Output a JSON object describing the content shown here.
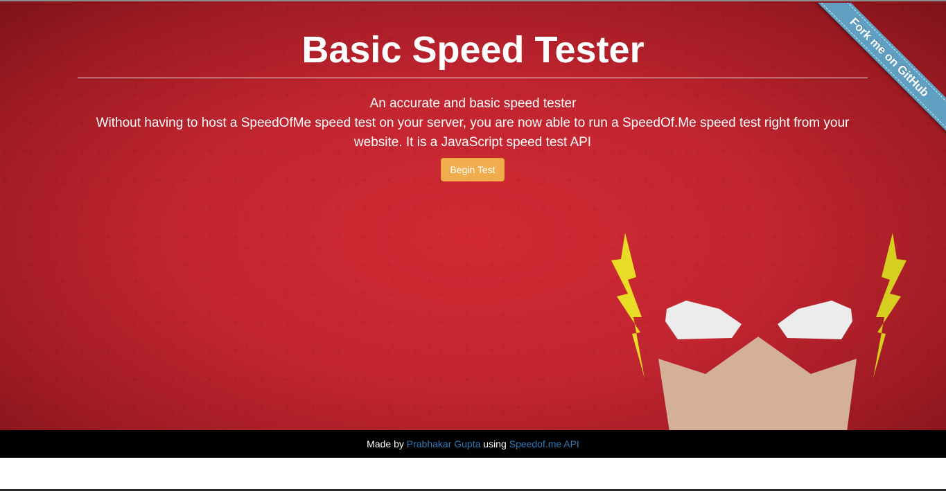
{
  "header": {
    "title": "Basic Speed Tester"
  },
  "intro": {
    "subtitle": "An accurate and basic speed tester",
    "description": "Without having to host a SpeedOfMe speed test on your server, you are now able to run a SpeedOf.Me speed test right from your website. It is a JavaScript speed test API"
  },
  "actions": {
    "begin_label": "Begin Test"
  },
  "ribbon": {
    "label": "Fork me on GitHub"
  },
  "footer": {
    "made_by": "Made by",
    "author": "Prabhakar Gupta",
    "using": "using",
    "api": "Speedof.me API"
  },
  "colors": {
    "hero_red": "#c12530",
    "button_orange": "#f0ad4e",
    "ribbon_blue": "#5f9fc2",
    "link_blue": "#337ab7",
    "footer_black": "#000000"
  },
  "icons": {
    "hero_art": "flash-mask-illustration"
  }
}
